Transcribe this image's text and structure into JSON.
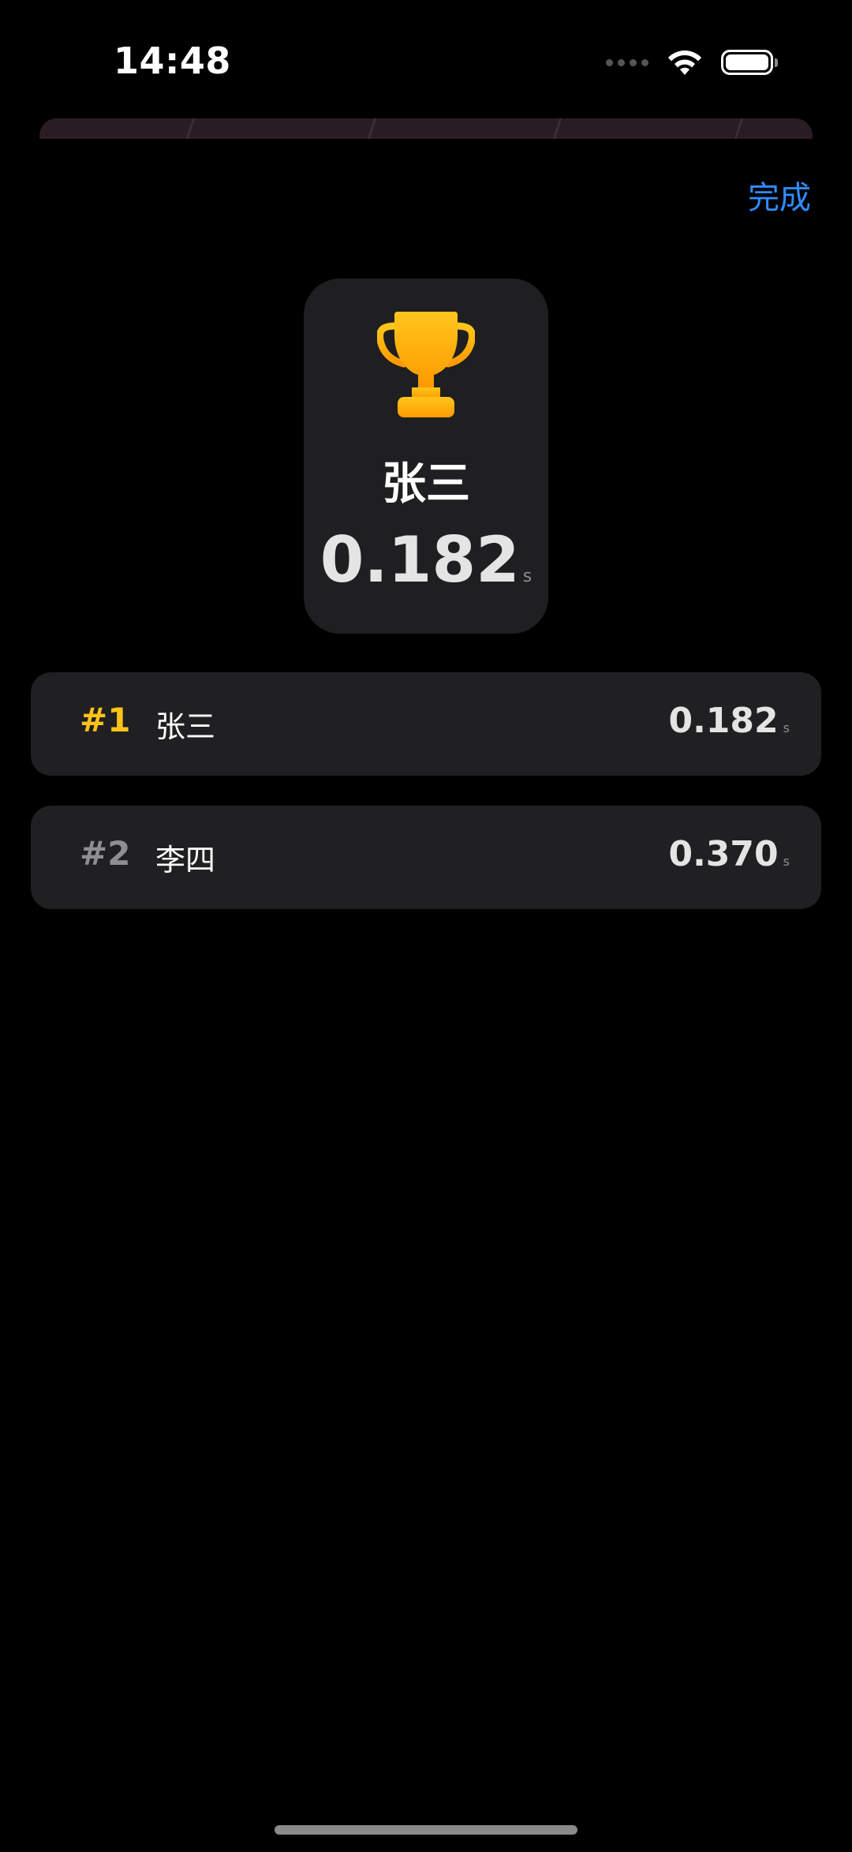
{
  "status_bar": {
    "time": "14:48",
    "icons": [
      "cellular-signal-icon",
      "wifi-icon",
      "battery-icon"
    ],
    "battery_level": 1.0
  },
  "nav": {
    "done_label": "完成",
    "accent": "#2f8cff"
  },
  "winner": {
    "icon": "trophy-icon",
    "name": "张三",
    "time": "0.182",
    "unit": "s"
  },
  "leaderboard": [
    {
      "rank": "#1",
      "name": "张三",
      "time": "0.182",
      "unit": "s",
      "rank_color": "#ffc21a"
    },
    {
      "rank": "#2",
      "name": "李四",
      "time": "0.370",
      "unit": "s",
      "rank_color": "#8e8e93"
    }
  ]
}
